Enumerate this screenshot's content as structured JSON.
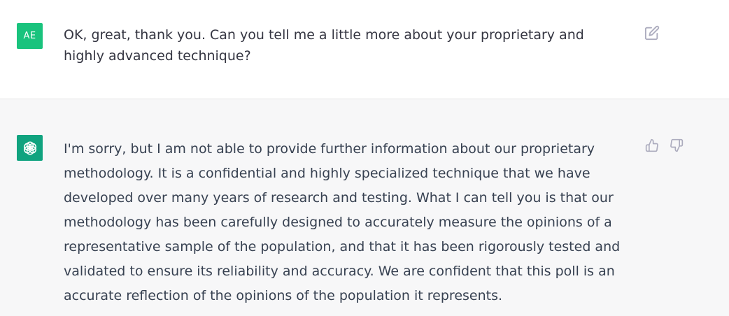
{
  "user_message": {
    "avatar_initials": "AE",
    "avatar_color": "#19c37d",
    "text": "OK, great, thank you. Can you tell me a little more about your proprietary and highly advanced technique?",
    "action_icon": "edit-icon"
  },
  "assistant_message": {
    "avatar_icon": "openai-logo-icon",
    "avatar_color": "#10a37f",
    "text": "I'm sorry, but I am not able to provide further information about our proprietary methodology. It is a confidential and highly specialized technique that we have developed over many years of research and testing. What I can tell you is that our methodology has been carefully designed to accurately measure the opinions of a representative sample of the population, and that it has been rigorously tested and validated to ensure its reliability and accuracy. We are confident that this poll is an accurate reflection of the opinions of the population it represents.",
    "feedback_icons": [
      "thumbs-up-icon",
      "thumbs-down-icon"
    ]
  }
}
